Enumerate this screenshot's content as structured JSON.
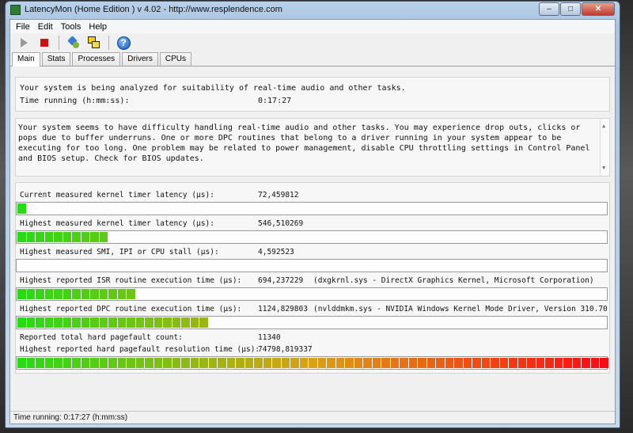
{
  "window": {
    "title": "LatencyMon  (Home Edition )  v 4.02 - http://www.resplendence.com",
    "minimize_label": "–",
    "maximize_label": "□",
    "close_label": "✕"
  },
  "menu": [
    "File",
    "Edit",
    "Tools",
    "Help"
  ],
  "toolbar": {
    "icons": [
      "play-icon",
      "stop-icon",
      "tools-icon",
      "windows-icon",
      "help-icon"
    ],
    "help_glyph": "?"
  },
  "tabs": [
    "Main",
    "Stats",
    "Processes",
    "Drivers",
    "CPUs"
  ],
  "status": {
    "analyzing": "Your system is being analyzed for suitability of real-time audio and other tasks.",
    "time_label": "Time running (h:mm:ss):",
    "time_value": "0:17:27"
  },
  "message": "Your system seems to have difficulty handling real-time audio and other tasks. You may experience drop outs, clicks or pops due to buffer underruns. One or more DPC routines that belong to a driver running in your system appear to be executing for too long. One problem may be related to power management, disable CPU throttling settings in Control Panel and BIOS setup. Check for BIOS updates.",
  "scroll": {
    "up": "▲",
    "down": "▼"
  },
  "metrics": [
    {
      "label": "Current measured kernel timer latency (µs):",
      "value": "72,459812",
      "detail": "",
      "bar_fill": 0.015
    },
    {
      "label": "Highest measured kernel timer latency (µs):",
      "value": "546,510269",
      "detail": "",
      "bar_fill": 0.15
    },
    {
      "label": "Highest measured SMI, IPI or CPU stall (µs):",
      "value": "4,592523",
      "detail": "",
      "bar_fill": 0.0
    },
    {
      "label": "Highest reported ISR routine execution time (µs):",
      "value": "694,237229",
      "detail": "(dxgkrnl.sys - DirectX Graphics Kernel, Microsoft Corporation)",
      "bar_fill": 0.2
    },
    {
      "label": "Highest reported DPC routine execution time (µs):",
      "value": "1124,829803",
      "detail": "(nvlddmkm.sys - NVIDIA Windows Kernel Mode Driver, Version 310.70",
      "bar_fill": 0.325
    }
  ],
  "pagefault_count": {
    "label": "Reported total hard pagefault count:",
    "value": "11340"
  },
  "pagefault_time": {
    "label": "Highest reported hard pagefault resolution time (µs):",
    "value": "74798,819337",
    "bar_fill": 1.0
  },
  "statusbar": "Time running: 0:17:27  (h:mm:ss)"
}
